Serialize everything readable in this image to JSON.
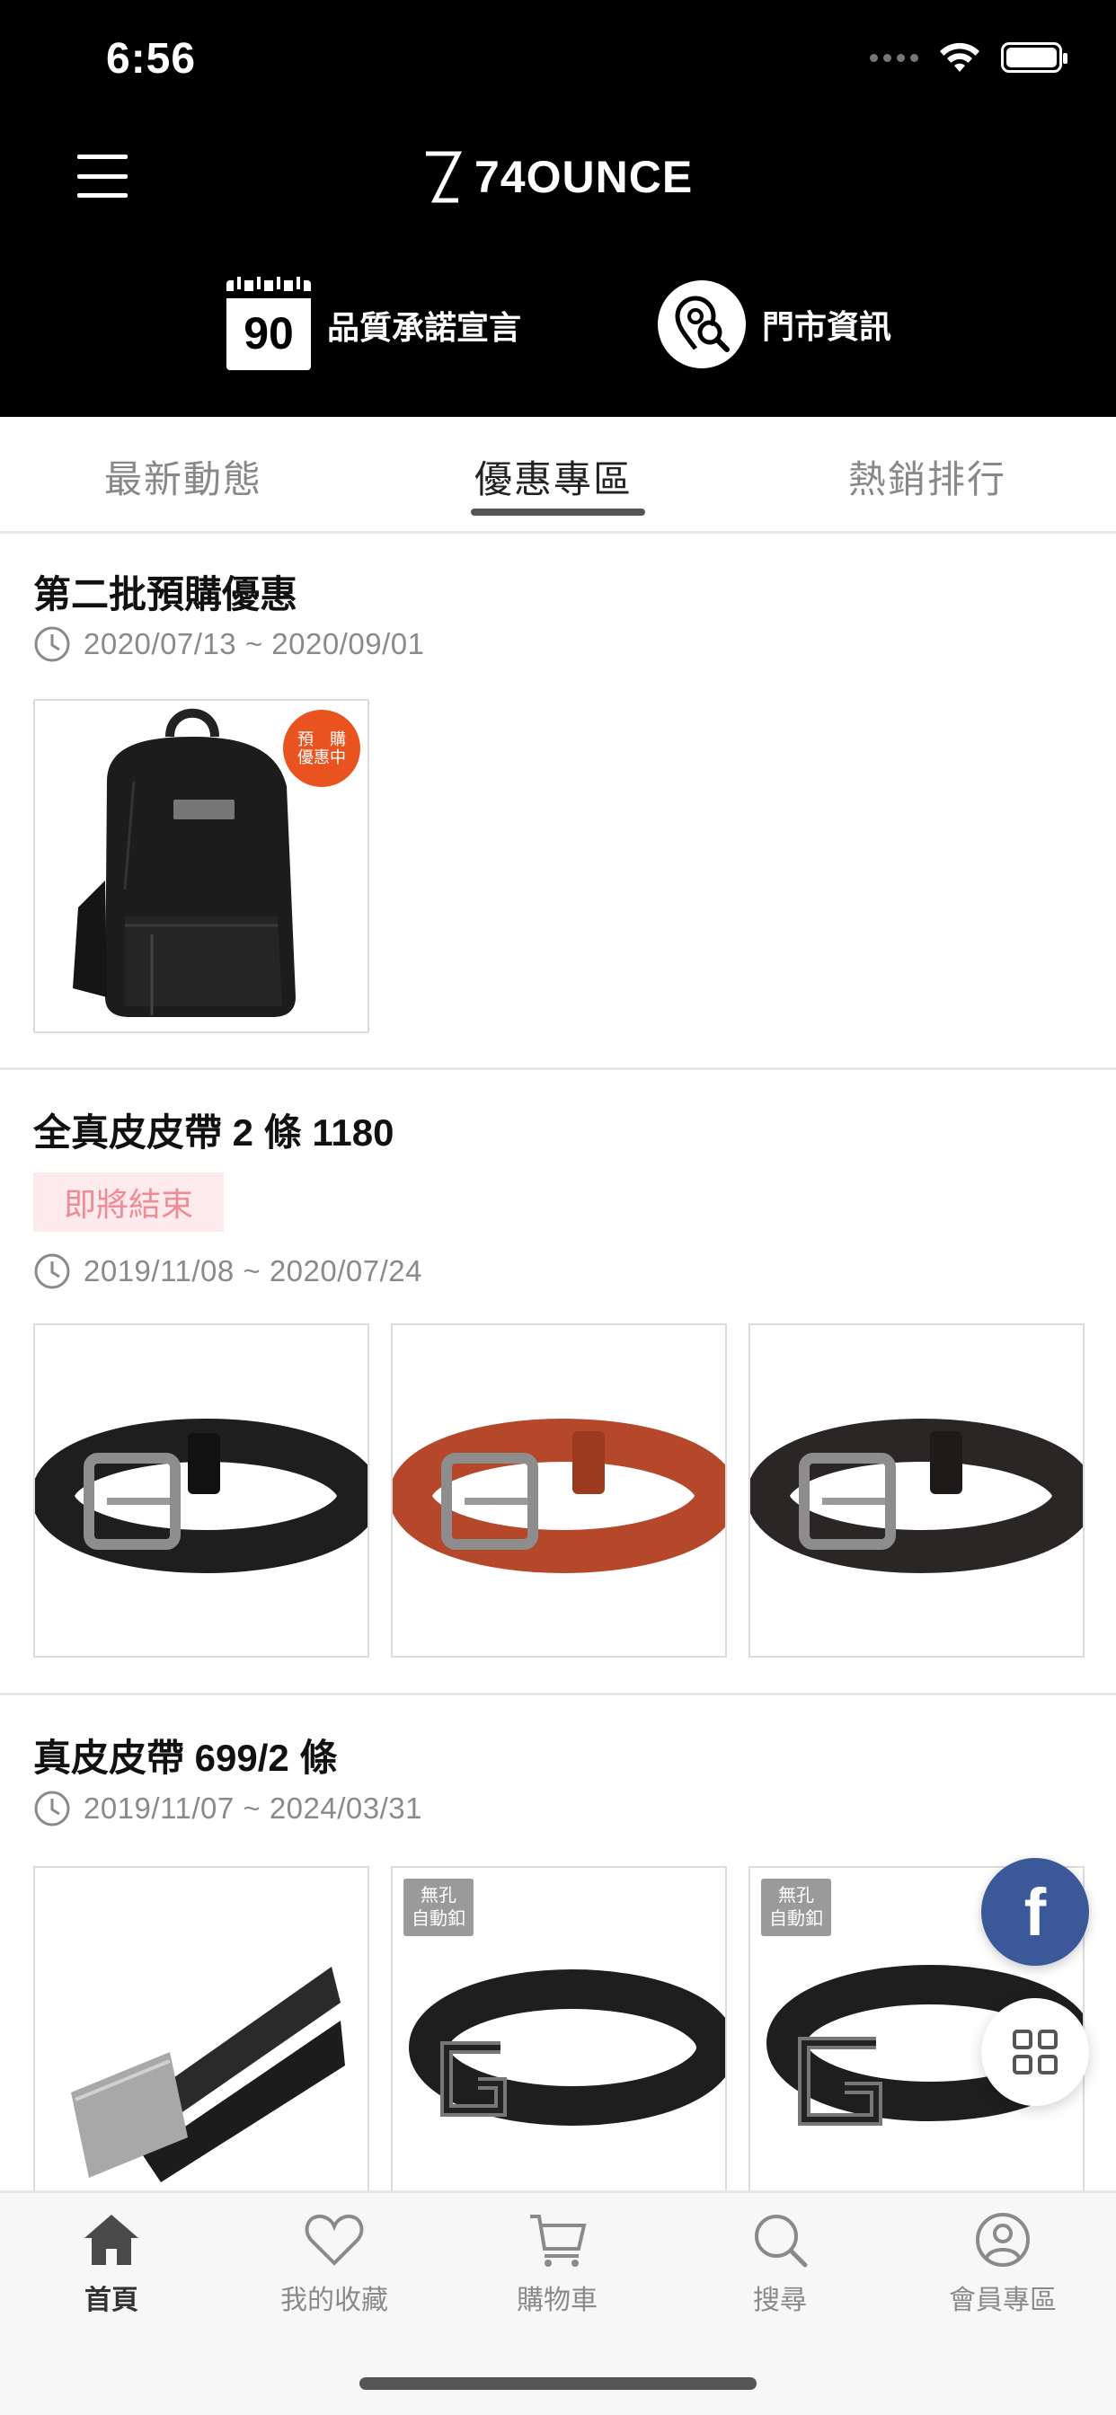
{
  "status_bar": {
    "time": "6:56"
  },
  "header": {
    "brand": "74OUNCE",
    "quick_links": [
      {
        "icon": "calendar-90-icon",
        "badge": "90",
        "label": "品質承諾宣言"
      },
      {
        "icon": "store-search-icon",
        "label": "門市資訊"
      }
    ]
  },
  "tabs": [
    {
      "label": "最新動態",
      "active": false
    },
    {
      "label": "優惠專區",
      "active": true
    },
    {
      "label": "熱銷排行",
      "active": false
    }
  ],
  "promotions": [
    {
      "title": "第二批預購優惠",
      "date_range": "2020/07/13 ~ 2020/09/01",
      "products": [
        {
          "image": "black-backpack",
          "badge": {
            "line1": "預　購",
            "line2": "優惠中"
          }
        }
      ]
    },
    {
      "title": "全真皮皮帶 2 條 1180",
      "status_tag": "即將結束",
      "date_range": "2019/11/08 ~ 2020/07/24",
      "products": [
        {
          "image": "black-leather-belt"
        },
        {
          "image": "brown-leather-belt"
        },
        {
          "image": "dark-brown-leather-belt"
        }
      ]
    },
    {
      "title": "真皮皮帶 699/2 條",
      "date_range": "2019/11/07 ~ 2024/03/31",
      "products": [
        {
          "image": "black-plate-buckle-belt"
        },
        {
          "image": "black-g-buckle-belt",
          "badge": {
            "line1": "無孔",
            "line2": "自動釦"
          }
        },
        {
          "image": "black-g-buckle-belt",
          "badge": {
            "line1": "無孔",
            "line2": "自動釦"
          }
        }
      ]
    }
  ],
  "floating": {
    "facebook_label": "f"
  },
  "bottom_nav": [
    {
      "icon": "home-icon",
      "label": "首頁",
      "active": true
    },
    {
      "icon": "heart-icon",
      "label": "我的收藏",
      "active": false
    },
    {
      "icon": "cart-icon",
      "label": "購物車",
      "active": false
    },
    {
      "icon": "search-icon",
      "label": "搜尋",
      "active": false
    },
    {
      "icon": "user-icon",
      "label": "會員專區",
      "active": false
    }
  ],
  "colors": {
    "header_bg": "#000000",
    "preorder_badge": "#e9531f",
    "ending_tag_bg": "#fdeaec",
    "ending_tag_text": "#f08a94",
    "facebook": "#3b5998"
  }
}
